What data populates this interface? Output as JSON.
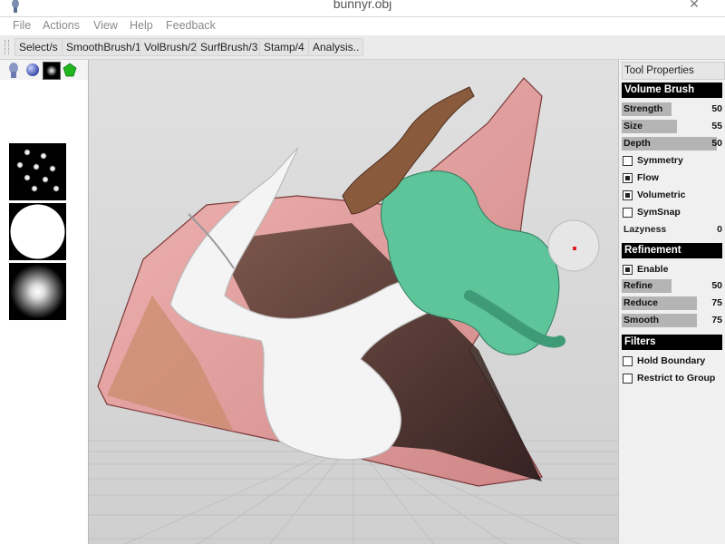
{
  "window": {
    "title": "bunnyr.obj",
    "close_glyph": "✕"
  },
  "menu": [
    "File",
    "Actions",
    "View",
    "Help",
    "Feedback"
  ],
  "toolbar": [
    "Select/s",
    "SmoothBrush/1",
    "VolBrush/2",
    "SurfBrush/3",
    "Stamp/4",
    "Analysis.."
  ],
  "left_panel": {
    "icons": [
      "head-icon",
      "sphere-icon",
      "square-stamp-icon",
      "pentagon-icon"
    ],
    "brush_tiles": [
      "dots-alpha",
      "hard-circle-alpha",
      "soft-circle-alpha"
    ]
  },
  "tool_properties": {
    "title": "Tool Properties",
    "volume_brush": {
      "header": "Volume Brush",
      "sliders": [
        {
          "label": "Strength",
          "value": "50",
          "fill": 0.5
        },
        {
          "label": "Size",
          "value": "55",
          "fill": 0.55
        },
        {
          "label": "Depth",
          "value": "50",
          "fill": 0.95
        }
      ],
      "checkboxes": [
        {
          "label": "Symmetry",
          "checked": false
        },
        {
          "label": "Flow",
          "checked": true
        },
        {
          "label": "Volumetric",
          "checked": true
        },
        {
          "label": "SymSnap",
          "checked": false
        }
      ],
      "lazyness": {
        "label": "Lazyness",
        "value": "0"
      }
    },
    "refinement": {
      "header": "Refinement",
      "enable": {
        "label": "Enable",
        "checked": true
      },
      "sliders": [
        {
          "label": "Refine",
          "value": "50",
          "fill": 0.5
        },
        {
          "label": "Reduce",
          "value": "75",
          "fill": 0.75
        },
        {
          "label": "Smooth",
          "value": "75",
          "fill": 0.75
        }
      ]
    },
    "filters": {
      "header": "Filters",
      "checkboxes": [
        {
          "label": "Hold Boundary",
          "checked": false
        },
        {
          "label": "Restrict to Group",
          "checked": false
        }
      ]
    }
  },
  "colors": {
    "viewport_bg": "#d6d6d6",
    "mesh_pink": "#e7a2a3",
    "mesh_green": "#5ec49a",
    "mesh_white": "#f2f2f2",
    "mesh_brown": "#8a5a3c",
    "section_header": "#000000",
    "slider_fill": "#b4b4b4"
  }
}
